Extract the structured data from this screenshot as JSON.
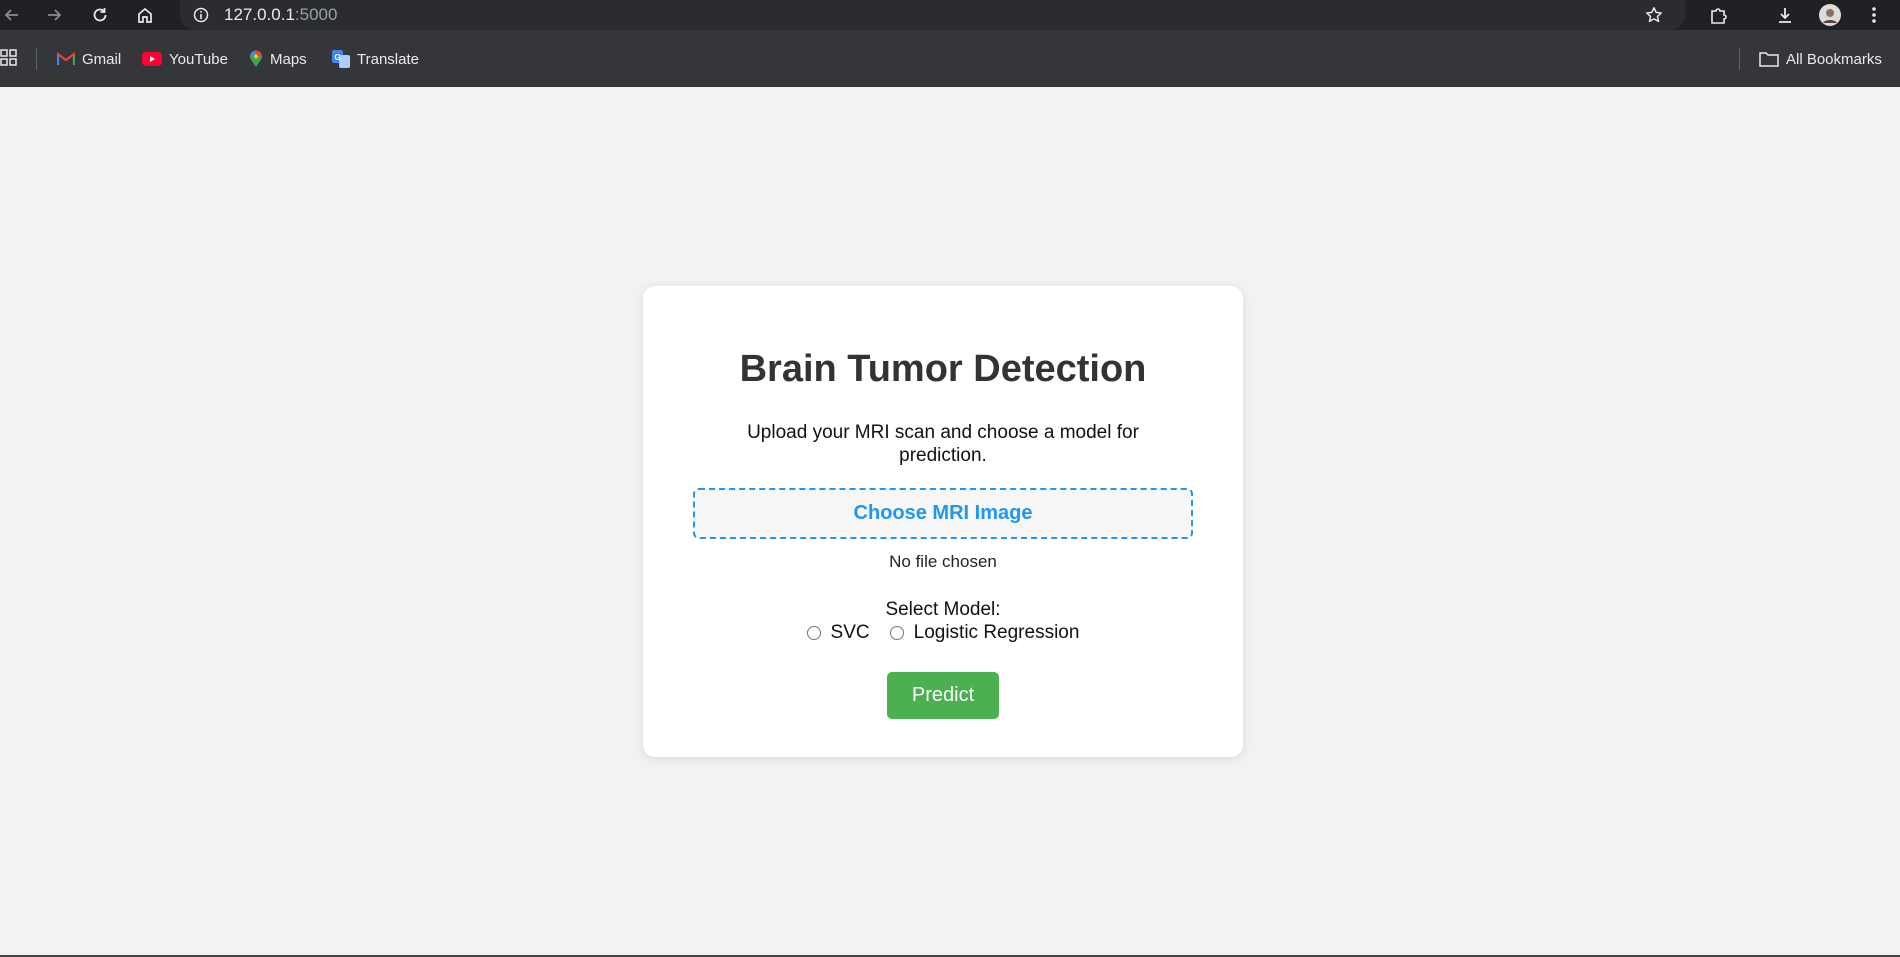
{
  "browser": {
    "url_host": "127.0.0.1",
    "url_port": ":5000",
    "bookmarks": [
      {
        "label": "Gmail",
        "icon": "gmail-icon"
      },
      {
        "label": "YouTube",
        "icon": "youtube-icon"
      },
      {
        "label": "Maps",
        "icon": "maps-icon"
      },
      {
        "label": "Translate",
        "icon": "translate-icon"
      }
    ],
    "all_bookmarks_label": "All Bookmarks"
  },
  "page": {
    "title": "Brain Tumor Detection",
    "subtitle": "Upload your MRI scan and choose a model for prediction.",
    "file_button_label": "Choose MRI Image",
    "file_status": "No file chosen",
    "model_label": "Select Model:",
    "models": [
      {
        "label": "SVC",
        "selected": false
      },
      {
        "label": "Logistic Regression",
        "selected": false
      }
    ],
    "predict_label": "Predict"
  },
  "colors": {
    "accent": "#2196f3",
    "predict_button": "#4caf50",
    "background": "#f2f2f2"
  }
}
